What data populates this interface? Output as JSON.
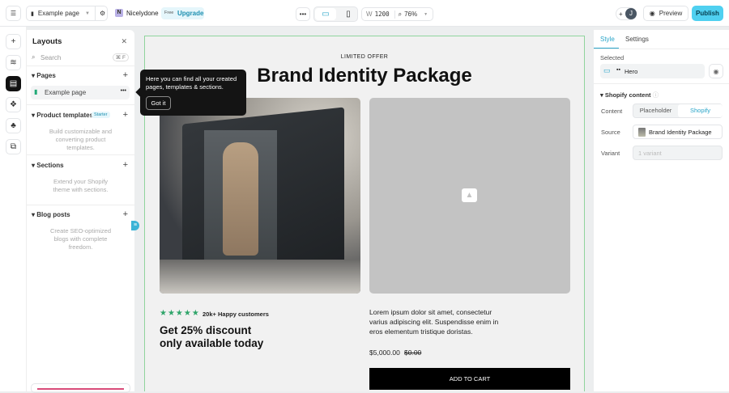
{
  "topbar": {
    "page_name": "Example page",
    "workspace_initial": "N",
    "workspace": "Nicelydone",
    "plan_badge": "Free",
    "upgrade": "Upgrade",
    "width_label": "W",
    "width_value": "1200",
    "zoom": "76%",
    "avatar_initial": "J",
    "preview": "Preview",
    "publish": "Publish"
  },
  "layouts": {
    "title": "Layouts",
    "search_placeholder": "Search",
    "search_shortcut": "⌘ F",
    "pages": {
      "title": "Pages",
      "items": [
        {
          "label": "Example page"
        }
      ]
    },
    "product_templates": {
      "title": "Product templates",
      "badge": "Starter",
      "desc": "Build customizable and converting product templates."
    },
    "sections": {
      "title": "Sections",
      "desc": "Extend your Shopify theme with sections."
    },
    "blog_posts": {
      "title": "Blog posts",
      "desc": "Create SEO-optimized blogs with complete freedom."
    }
  },
  "tooltip": {
    "text": "Here you can find all your created pages, templates & sections.",
    "button": "Got it"
  },
  "canvas": {
    "eyebrow": "LIMITED OFFER",
    "title": "Brand Identity Package",
    "rating_text": "20k+ Happy customers",
    "stars": 5,
    "promo_line1": "Get 25% discount",
    "promo_line2": "only available today",
    "description": "Lorem ipsum dolor sit amet, consectetur varius adipiscing elit. Suspendisse enim in eros elementum tristique doristas.",
    "price": "$5,000.00",
    "compare_price": "$0.00",
    "cta": "ADD TO CART"
  },
  "inspector": {
    "tabs": [
      "Style",
      "Settings"
    ],
    "selected_label": "Selected",
    "selected_element": "Hero",
    "section_title": "Shopify content",
    "content_label": "Content",
    "content_options": [
      "Placeholder",
      "Shopify"
    ],
    "source_label": "Source",
    "source_value": "Brand Identity Package",
    "variant_label": "Variant",
    "variant_placeholder": "1 variant"
  },
  "colors": {
    "accent": "#3bb3d6",
    "publish": "#4fd0f0",
    "star": "#2fa56a",
    "frame": "#8fd49d"
  }
}
